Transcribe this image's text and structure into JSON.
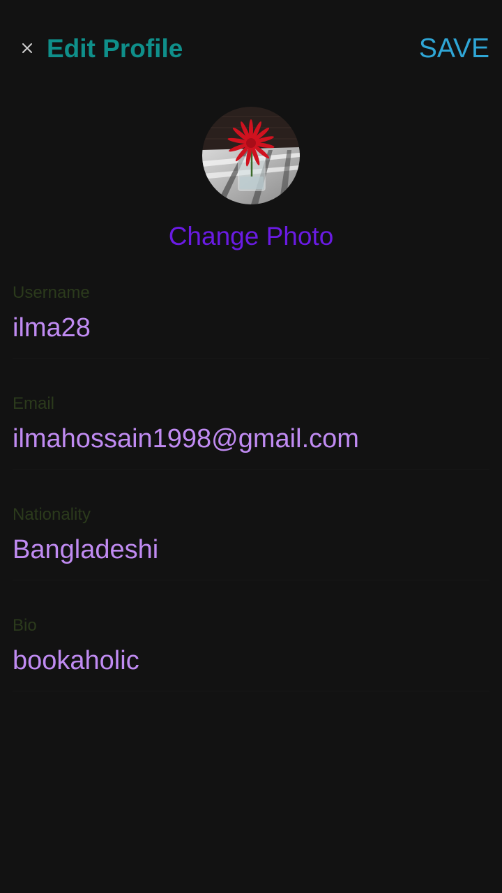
{
  "header": {
    "close_glyph": "×",
    "title": "Edit Profile",
    "save_label": "SAVE"
  },
  "profile": {
    "change_photo_label": "Change Photo"
  },
  "fields": [
    {
      "label": "Username",
      "value": "ilma28"
    },
    {
      "label": "Email",
      "value": "ilmahossain1998@gmail.com"
    },
    {
      "label": "Nationality",
      "value": "Bangladeshi"
    },
    {
      "label": "Bio",
      "value": "bookaholic"
    }
  ],
  "colors": {
    "background": "#121212",
    "title": "#0f8f8a",
    "save": "#2fa6d6",
    "change_photo": "#6a1be3",
    "field_label": "#2b3a1c",
    "field_value": "#c08bf2"
  },
  "icons": {
    "close": "close-icon"
  }
}
